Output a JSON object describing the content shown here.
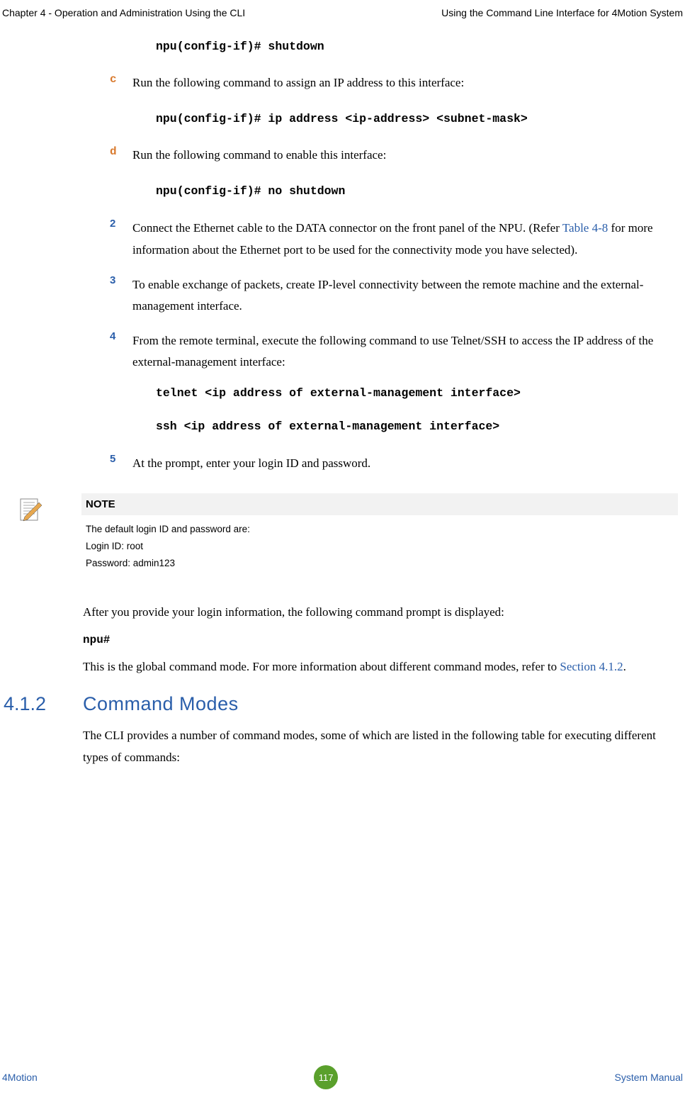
{
  "header": {
    "left": "Chapter 4 - Operation and Administration Using the CLI",
    "right": "Using the Command Line Interface for 4Motion System"
  },
  "commands": {
    "shutdown": "npu(config-if)# shutdown",
    "ipaddress": "npu(config-if)# ip address <ip-address> <subnet-mask>",
    "noshutdown": "npu(config-if)# no shutdown",
    "telnet": "telnet <ip address of external-management interface>",
    "ssh": "ssh <ip address of external-management interface>"
  },
  "subitems": {
    "c": {
      "letter": "c",
      "text": "Run the following command to assign an IP address to this interface:"
    },
    "d": {
      "letter": "d",
      "text": "Run the following command to enable this interface:"
    }
  },
  "numitems": {
    "n2": {
      "num": "2",
      "pre": "Connect the Ethernet cable to the DATA connector on the front panel of the NPU. (Refer ",
      "link": "Table 4-8",
      "post": " for more information about the Ethernet port to be used for the connectivity mode you have selected)."
    },
    "n3": {
      "num": "3",
      "text": "To enable exchange of packets, create IP-level connectivity between the remote machine and the external-management interface."
    },
    "n4": {
      "num": "4",
      "text": "From the remote terminal, execute the following command to use Telnet/SSH to access the IP address of the external-management interface:"
    },
    "n5": {
      "num": "5",
      "text": "At the prompt, enter your login ID and password."
    }
  },
  "note": {
    "title": "NOTE",
    "line1": "The default login ID and password are:",
    "line2": "Login ID: root",
    "line3": "Password: admin123"
  },
  "body": {
    "p1": "After you provide your login information, the following command prompt is displayed:",
    "prompt": "npu#",
    "p2pre": "This is the global command mode. For more information about different command modes, refer to ",
    "p2link": "Section 4.1.2",
    "p2post": "."
  },
  "section": {
    "num": "4.1.2",
    "title": "Command Modes",
    "text": "The CLI provides a number of command modes, some of which are listed in the following table for executing different types of commands:"
  },
  "footer": {
    "left": "4Motion",
    "page": "117",
    "right": "System Manual"
  }
}
